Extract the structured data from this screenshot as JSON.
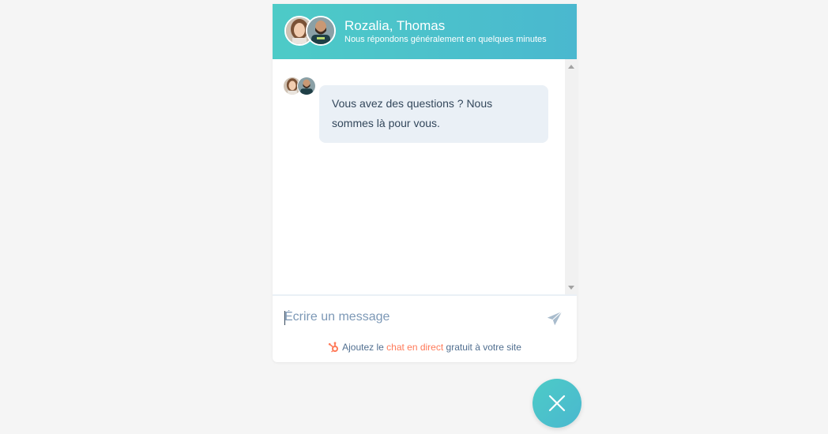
{
  "colors": {
    "header_gradient_start": "#4dcbc7",
    "header_gradient_end": "#4ab8cf",
    "bubble_bg": "#eaf0f6",
    "text_primary": "#33475b",
    "placeholder": "#7c98b6",
    "link": "#ff7a59",
    "page_bg": "#f5f5f5"
  },
  "header": {
    "names": "Rozalia, Thomas",
    "subtitle": "Nous répondons généralement en quelques minutes",
    "avatars": [
      "avatar-rozalia",
      "avatar-thomas"
    ]
  },
  "messages": [
    {
      "sender_avatars": [
        "avatar-rozalia",
        "avatar-thomas"
      ],
      "text": "Vous avez des questions ? Nous sommes là pour vous."
    }
  ],
  "composer": {
    "placeholder": "Écrire un message",
    "send_icon": "paper-plane-icon"
  },
  "branding": {
    "icon": "hubspot-sprocket-icon",
    "prefix": "Ajoutez le ",
    "link_text": "chat en direct",
    "suffix": " gratuit à votre site"
  },
  "launcher": {
    "icon": "close-icon"
  }
}
